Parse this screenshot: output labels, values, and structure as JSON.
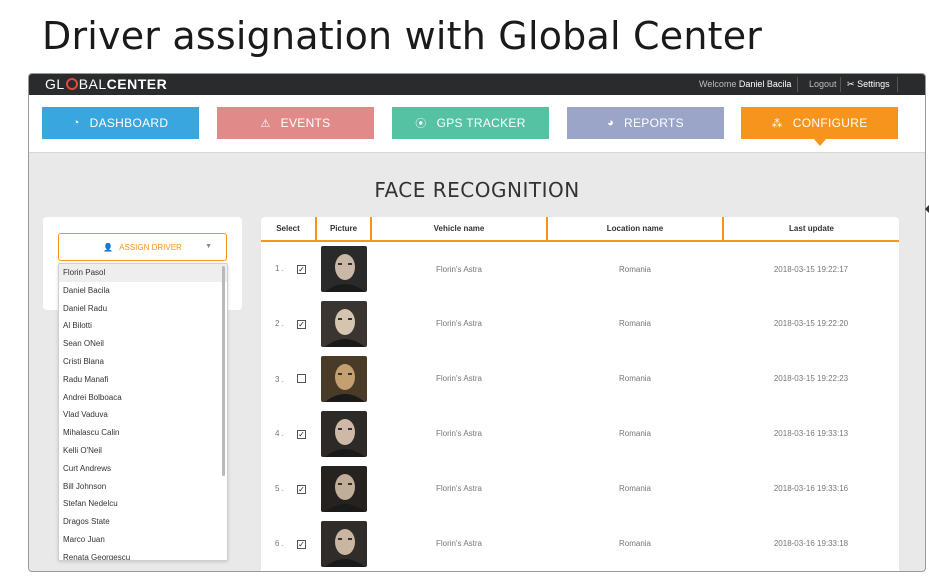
{
  "slide": {
    "title": "Driver assignation with Global Center"
  },
  "app": {
    "logo_left": "GL",
    "logo_mid": "BAL",
    "logo_bold": "CENTER",
    "welcome_label": "Welcome",
    "user_name": "Daniel Bacila",
    "logout_label": "Logout",
    "settings_label": "Settings"
  },
  "nav": {
    "dashboard": "DASHBOARD",
    "events": "EVENTS",
    "gps": "GPS TRACKER",
    "reports": "REPORTS",
    "configure": "CONFIGURE"
  },
  "colors": {
    "dashboard": "#3aa6e0",
    "events": "#e08a8a",
    "gps": "#56c2a4",
    "reports": "#9aa5c7",
    "configure": "#f7941d"
  },
  "page": {
    "title": "FACE RECOGNITION"
  },
  "assign": {
    "button_label": "ASSIGN DRIVER",
    "drivers": [
      "Florin Pasol",
      "Daniel Bacila",
      "Daniel Radu",
      "Al Bilotti",
      "Sean ONeil",
      "Cristi Blana",
      "Radu Manafi",
      "Andrei Bolboaca",
      "Vlad Vaduva",
      "Mihalascu Calin",
      "Kelli O'Neil",
      "Curt Andrews",
      "Bill Johnson",
      "Stefan Nedelcu",
      "Dragos State",
      "Marco Juan",
      "Renata Georgescu"
    ],
    "selected": "Florin Pasol"
  },
  "table": {
    "headers": {
      "select": "Select",
      "picture": "Picture",
      "vehicle": "Vehicle name",
      "location": "Location name",
      "updated": "Last update"
    },
    "rows": [
      {
        "num": "1 .",
        "checked": true,
        "vehicle": "Florin's Astra",
        "location": "Romania",
        "updated": "2018-03-15 19:22:17"
      },
      {
        "num": "2 .",
        "checked": true,
        "vehicle": "Florin's Astra",
        "location": "Romania",
        "updated": "2018-03-15 19:22:20"
      },
      {
        "num": "3 .",
        "checked": false,
        "vehicle": "Florin's Astra",
        "location": "Romania",
        "updated": "2018-03-15 19:22:23"
      },
      {
        "num": "4 .",
        "checked": true,
        "vehicle": "Florin's Astra",
        "location": "Romania",
        "updated": "2018-03-16 19:33:13"
      },
      {
        "num": "5 .",
        "checked": true,
        "vehicle": "Florin's Astra",
        "location": "Romania",
        "updated": "2018-03-16 19:33:16"
      },
      {
        "num": "6 .",
        "checked": true,
        "vehicle": "Florin's Astra",
        "location": "Romania",
        "updated": "2018-03-16 19:33:18"
      }
    ]
  }
}
